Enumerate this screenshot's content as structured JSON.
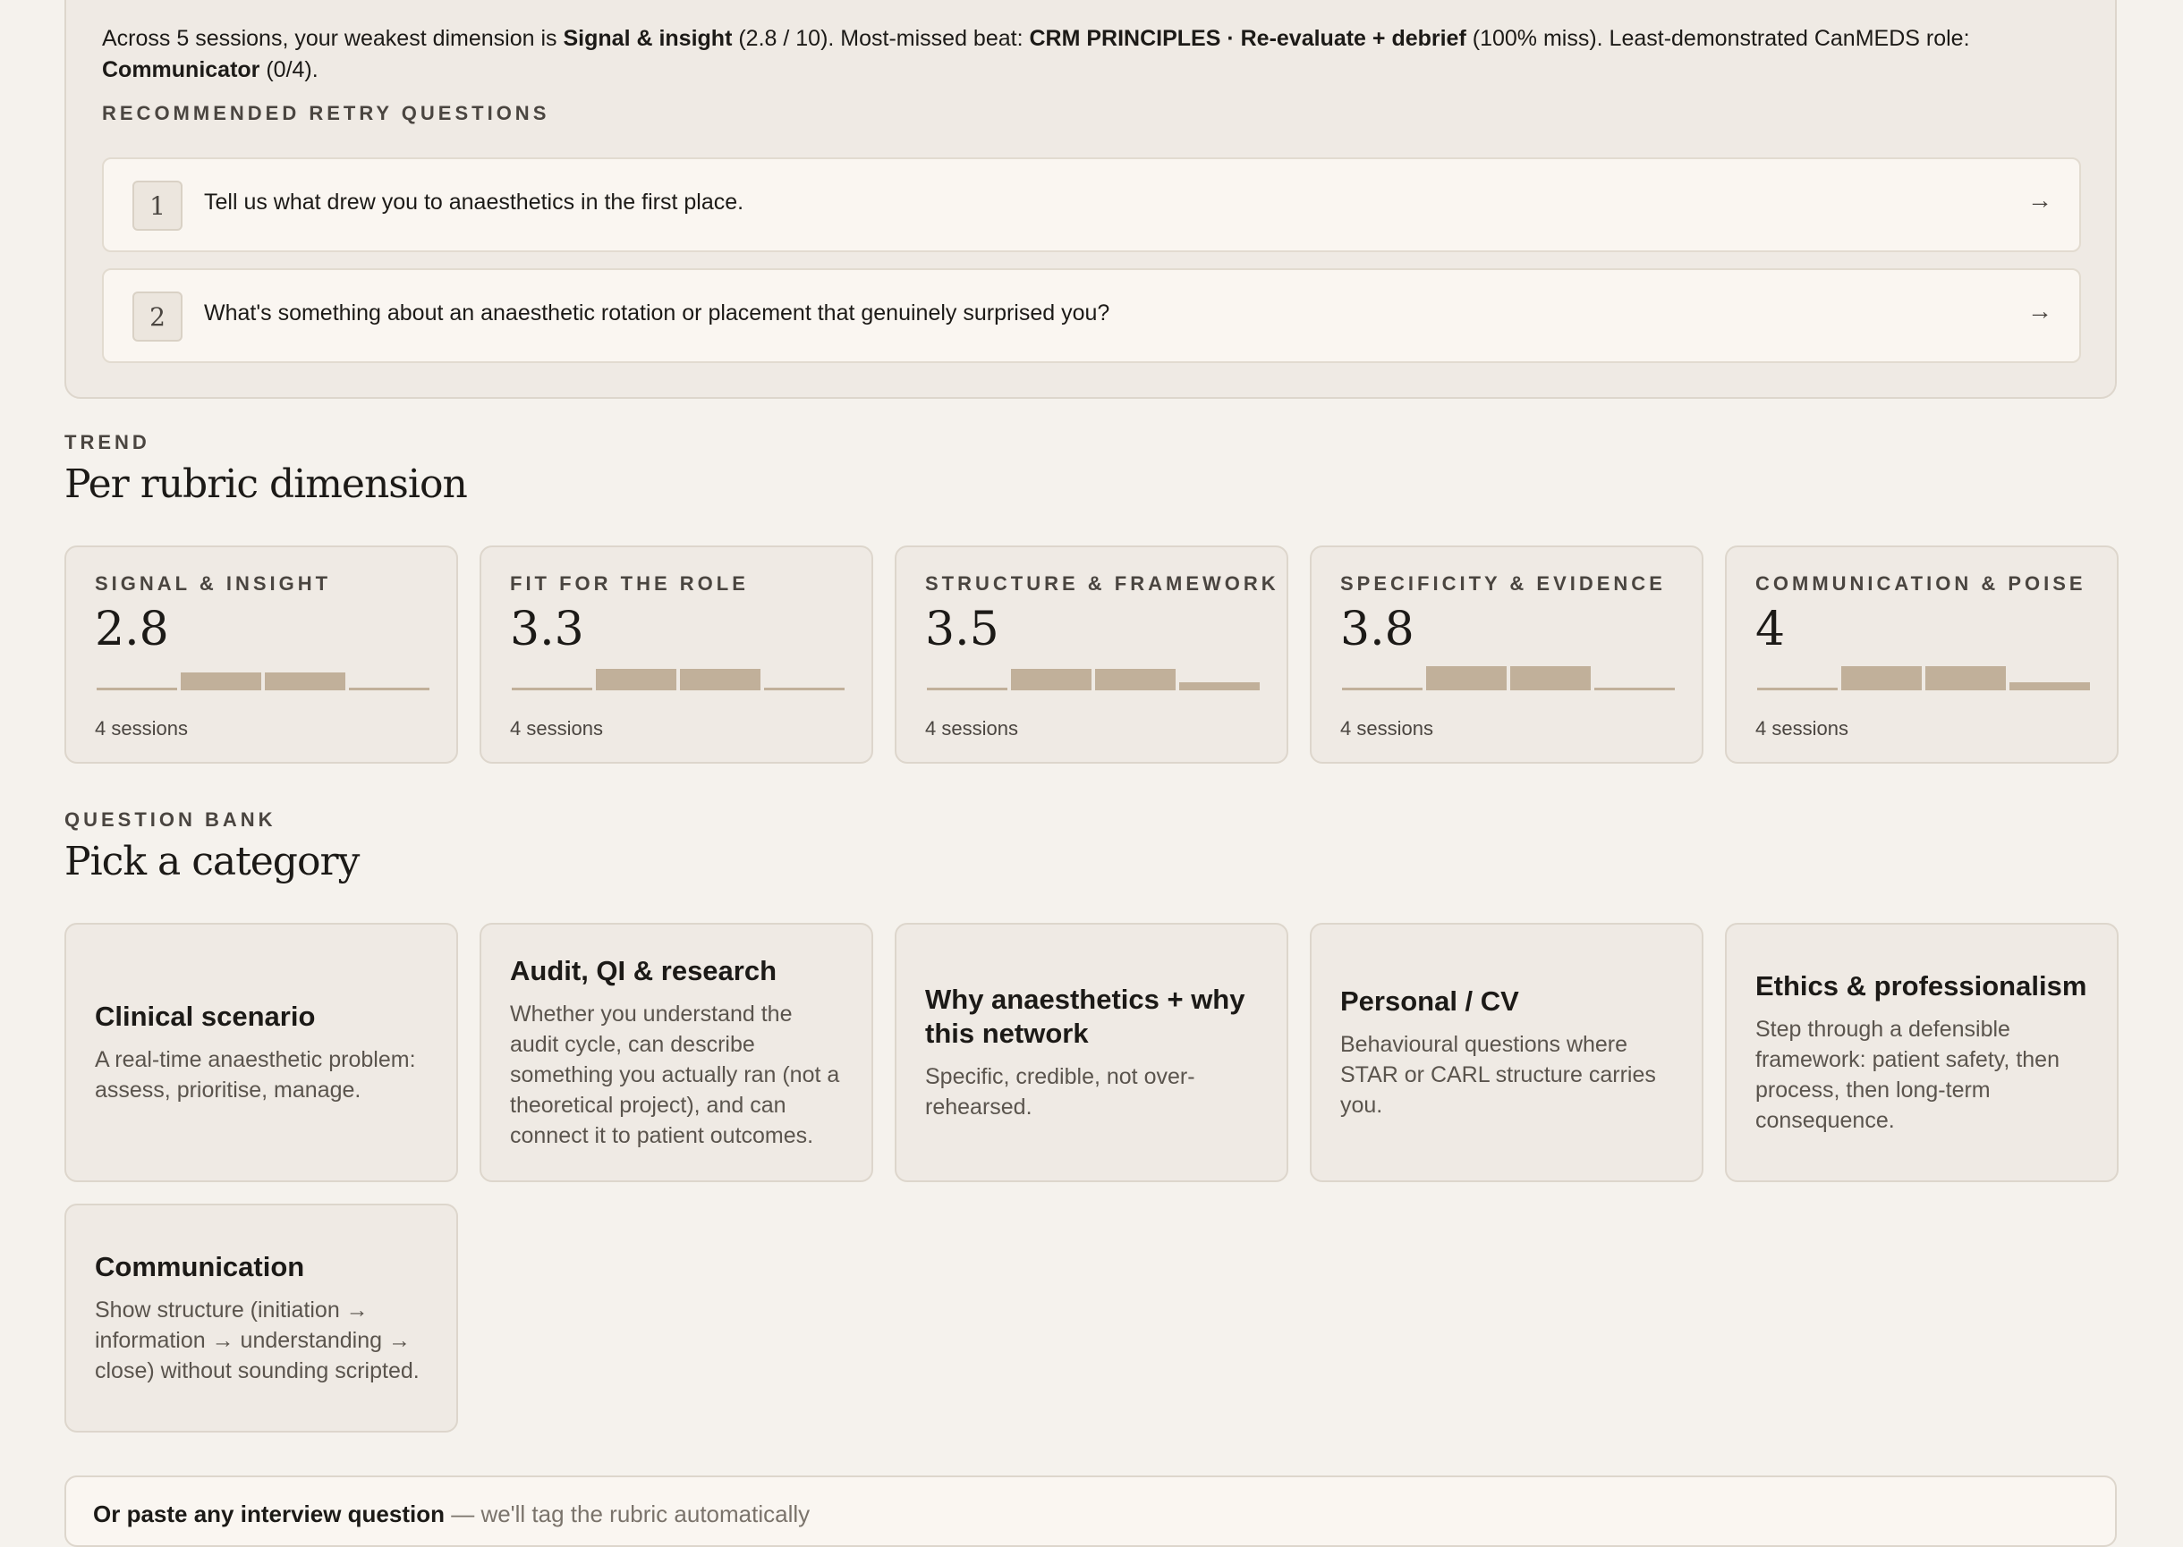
{
  "summary": {
    "prefix": "Across 5 sessions, your weakest dimension is ",
    "weakest": "Signal & insight",
    "weakest_score": " (2.8 / 10). Most-missed beat: ",
    "missed_beat": "CRM PRINCIPLES · Re-evaluate + debrief",
    "missed_pct": " (100% miss). Least-demonstrated CanMEDS role: ",
    "role": "Communicator",
    "role_score": " (0/4).",
    "retry_label": "RECOMMENDED RETRY QUESTIONS",
    "retries": [
      {
        "num": "1",
        "text": "Tell us what drew you to anaesthetics in the first place.",
        "arrow": "→"
      },
      {
        "num": "2",
        "text": "What's something about an anaesthetic rotation or placement that genuinely surprised you?",
        "arrow": "→"
      }
    ]
  },
  "trend": {
    "eyebrow": "TREND",
    "title": "Per rubric dimension",
    "cards": [
      {
        "label": "SIGNAL & INSIGHT",
        "score": "2.8",
        "sessions": "4 sessions",
        "bars": [
          0,
          0.6,
          0.6,
          0
        ]
      },
      {
        "label": "FIT FOR THE ROLE",
        "score": "3.3",
        "sessions": "4 sessions",
        "bars": [
          0,
          0.7,
          0.7,
          0
        ]
      },
      {
        "label": "STRUCTURE & FRAMEWORK",
        "score": "3.5",
        "sessions": "4 sessions",
        "bars": [
          0,
          0.7,
          0.7,
          0.25
        ]
      },
      {
        "label": "SPECIFICITY & EVIDENCE",
        "score": "3.8",
        "sessions": "4 sessions",
        "bars": [
          0,
          0.8,
          0.8,
          0
        ]
      },
      {
        "label": "COMMUNICATION & POISE",
        "score": "4",
        "sessions": "4 sessions",
        "bars": [
          0,
          0.8,
          0.8,
          0.25
        ]
      }
    ]
  },
  "bank": {
    "eyebrow": "QUESTION BANK",
    "title": "Pick a category",
    "categories": [
      {
        "title": "Clinical scenario",
        "desc": "A real-time anaesthetic problem: assess, prioritise, manage."
      },
      {
        "title": "Audit, QI & research",
        "desc": "Whether you understand the audit cycle, can describe something you actually ran (not a theoretical project), and can connect it to patient outcomes."
      },
      {
        "title": "Why anaesthetics + why this network",
        "desc": "Specific, credible, not over-rehearsed."
      },
      {
        "title": "Personal / CV",
        "desc": "Behavioural questions where STAR or CARL structure carries you."
      },
      {
        "title": "Ethics & professionalism",
        "desc": "Step through a defensible framework: patient safety, then process, then long-term consequence."
      },
      {
        "title": "Communication",
        "desc": "Show structure (initiation → information → understanding → close) without sounding scripted."
      }
    ]
  },
  "paste": {
    "title": "Or paste any interview question",
    "sub": " — we'll tag the rubric automatically"
  },
  "colors": {
    "bar": "#c1b09a",
    "bg": "#f5f2ed",
    "card": "#efeae4"
  }
}
